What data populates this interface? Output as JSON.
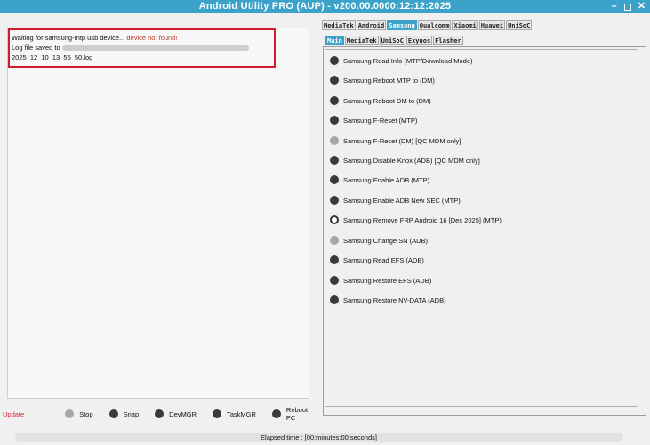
{
  "window": {
    "title": "Android Utility PRO (AUP) - v200.00.0000:12:12:2025",
    "controls": {
      "minimize": "–",
      "close": "✕"
    }
  },
  "log": {
    "line1_prefix": "Waiting for samsung-mtp usb device... ",
    "line1_status": "device not found!",
    "line2_prefix": "Log file saved to",
    "line3": "2025_12_10_13_55_50.log"
  },
  "bottom_bar": {
    "update_label": "Update",
    "buttons": [
      {
        "label": "Stop",
        "indicator": "light"
      },
      {
        "label": "Snap",
        "indicator": "dark"
      },
      {
        "label": "DevMGR",
        "indicator": "dark"
      },
      {
        "label": "TaskMGR",
        "indicator": "dark"
      },
      {
        "label": "Reboot PC",
        "indicator": "dark"
      }
    ]
  },
  "status": {
    "elapsed": "Elapsed time : [00:minutes:00:seconds]"
  },
  "top_tabs": [
    {
      "label": "MediaTek",
      "active": false
    },
    {
      "label": "Android",
      "active": false
    },
    {
      "label": "Samsung",
      "active": true
    },
    {
      "label": "Qualcomm",
      "active": false
    },
    {
      "label": "Xiaomi",
      "active": false
    },
    {
      "label": "Huawei",
      "active": false
    },
    {
      "label": "UniSoC",
      "active": false
    }
  ],
  "sub_tabs": [
    {
      "label": "Main",
      "active": true
    },
    {
      "label": "MediaTek",
      "active": false
    },
    {
      "label": "UniSoC",
      "active": false
    },
    {
      "label": "Exynos",
      "active": false
    },
    {
      "label": "Flasher",
      "active": false
    }
  ],
  "operations": [
    {
      "label": "Samsung Read Info (MTP/Download Mode)",
      "indicator": "dark"
    },
    {
      "label": "Samsung Reboot MTP to (DM)",
      "indicator": "dark"
    },
    {
      "label": "Samsung Reboot DM to (DM)",
      "indicator": "dark"
    },
    {
      "label": "Samsung F-Reset (MTP)",
      "indicator": "dark"
    },
    {
      "label": "Samsung F-Reset (DM) [QC MDM only]",
      "indicator": "light"
    },
    {
      "label": "Samsung Disable Knox (ADB) [QC MDM only]",
      "indicator": "dark"
    },
    {
      "label": "Samsung Enable ADB (MTP)",
      "indicator": "dark"
    },
    {
      "label": "Samsung Enable ADB New SEC (MTP)",
      "indicator": "dark"
    },
    {
      "label": "Samsung Remove FRP Android 16  [Dec 2025] (MTP)",
      "indicator": "ring"
    },
    {
      "label": "Samsung Change SN (ADB)",
      "indicator": "light"
    },
    {
      "label": "Samsung Read EFS (ADB)",
      "indicator": "dark"
    },
    {
      "label": "Samsung Restore EFS (ADB)",
      "indicator": "dark"
    },
    {
      "label": "Samsung Restore NV-DATA (ADB)",
      "indicator": "dark"
    }
  ],
  "colors": {
    "titlebar": "#3ba3c9",
    "error_text": "#c0392b",
    "highlight_box": "#d31a2a",
    "update_link": "#cc2a3a"
  }
}
